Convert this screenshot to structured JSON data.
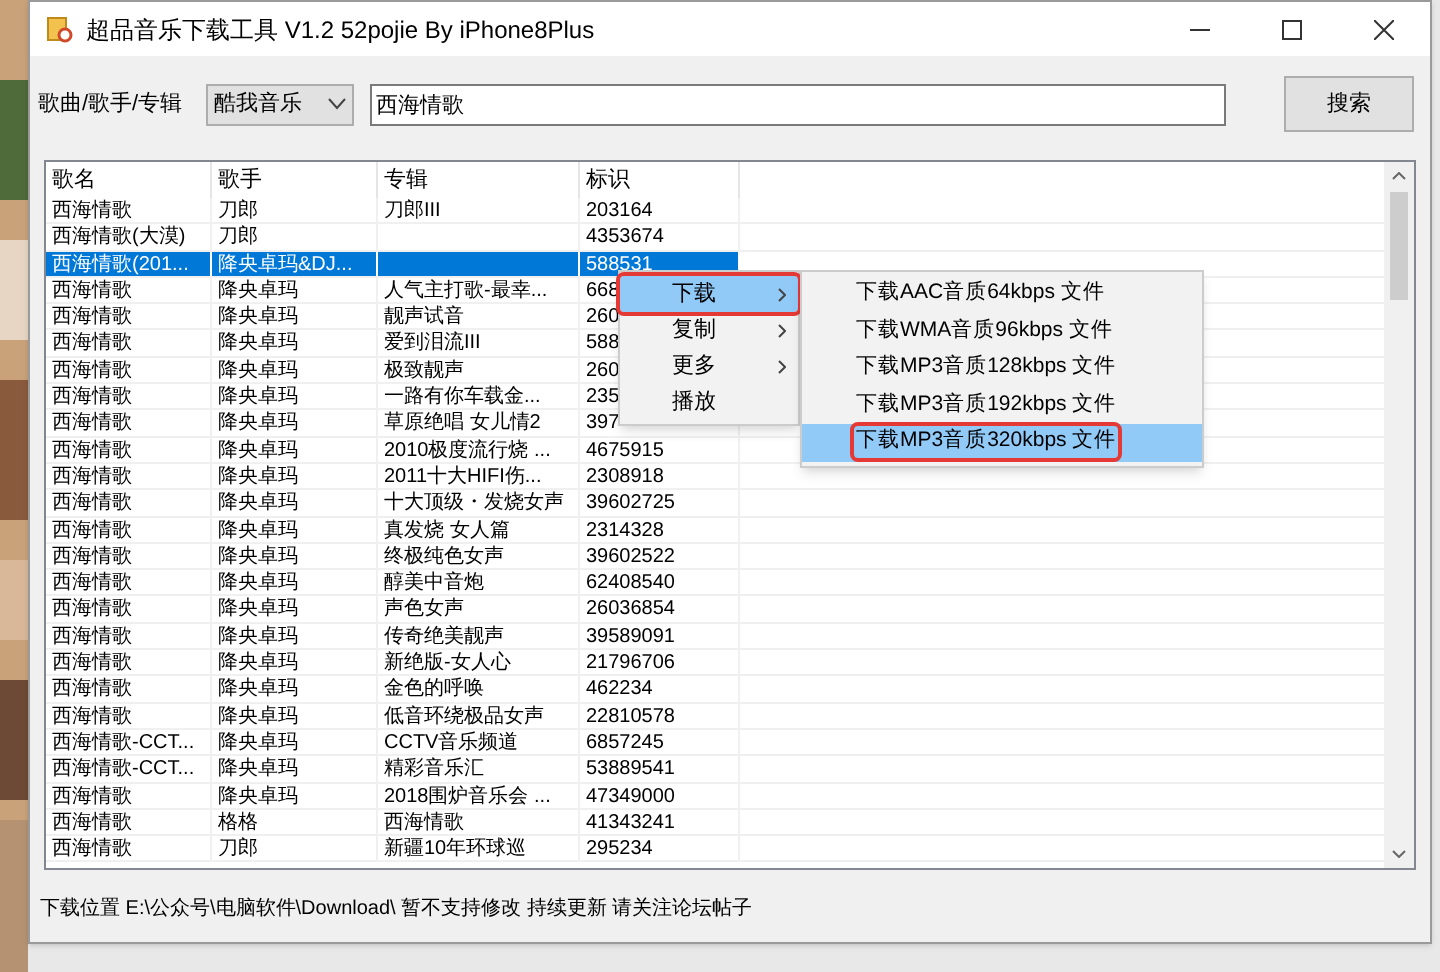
{
  "window": {
    "title": "超品音乐下载工具 V1.2 52pojie By iPhone8Plus"
  },
  "search": {
    "label": "歌曲/歌手/专辑",
    "source": "酷我音乐",
    "value": "西海情歌",
    "button": "搜索"
  },
  "table": {
    "columns": [
      "歌名",
      "歌手",
      "专辑",
      "标识"
    ],
    "rows": [
      {
        "cells": [
          "西海情歌",
          "刀郎",
          "刀郎III",
          "203164"
        ],
        "selected": false
      },
      {
        "cells": [
          "西海情歌(大漠)",
          "刀郎",
          null,
          "4353674"
        ],
        "selected": false
      },
      {
        "cells": [
          "西海情歌(201...",
          "降央卓玛&DJ...",
          null,
          "588531"
        ],
        "selected": true
      },
      {
        "cells": [
          "西海情歌",
          "降央卓玛",
          "人气主打歌-最幸...",
          "668"
        ],
        "selected": false
      },
      {
        "cells": [
          "西海情歌",
          "降央卓玛",
          "靓声试音",
          "260"
        ],
        "selected": false
      },
      {
        "cells": [
          "西海情歌",
          "降央卓玛",
          "爱到泪流III",
          "588"
        ],
        "selected": false
      },
      {
        "cells": [
          "西海情歌",
          "降央卓玛",
          "极致靓声",
          "260"
        ],
        "selected": false
      },
      {
        "cells": [
          "西海情歌",
          "降央卓玛",
          "一路有你车载金...",
          "235"
        ],
        "selected": false
      },
      {
        "cells": [
          "西海情歌",
          "降央卓玛",
          "草原绝唱 女儿情2",
          "397"
        ],
        "selected": false
      },
      {
        "cells": [
          "西海情歌",
          "降央卓玛",
          "2010极度流行烧 ...",
          "4675915"
        ],
        "selected": false
      },
      {
        "cells": [
          "西海情歌",
          "降央卓玛",
          "2011十大HIFI伤...",
          "2308918"
        ],
        "selected": false
      },
      {
        "cells": [
          "西海情歌",
          "降央卓玛",
          "十大顶级・发烧女声",
          "39602725"
        ],
        "selected": false
      },
      {
        "cells": [
          "西海情歌",
          "降央卓玛",
          "真发烧 女人篇",
          "2314328"
        ],
        "selected": false
      },
      {
        "cells": [
          "西海情歌",
          "降央卓玛",
          "终极纯色女声",
          "39602522"
        ],
        "selected": false
      },
      {
        "cells": [
          "西海情歌",
          "降央卓玛",
          "醇美中音炮",
          "62408540"
        ],
        "selected": false
      },
      {
        "cells": [
          "西海情歌",
          "降央卓玛",
          "声色女声",
          "26036854"
        ],
        "selected": false
      },
      {
        "cells": [
          "西海情歌",
          "降央卓玛",
          "传奇绝美靓声",
          "39589091"
        ],
        "selected": false
      },
      {
        "cells": [
          "西海情歌",
          "降央卓玛",
          "新绝版-女人心",
          "21796706"
        ],
        "selected": false
      },
      {
        "cells": [
          "西海情歌",
          "降央卓玛",
          "金色的呼唤",
          "462234"
        ],
        "selected": false
      },
      {
        "cells": [
          "西海情歌",
          "降央卓玛",
          "低音环绕极品女声",
          "22810578"
        ],
        "selected": false
      },
      {
        "cells": [
          "西海情歌-CCT...",
          "降央卓玛",
          "CCTV音乐频道",
          "6857245"
        ],
        "selected": false
      },
      {
        "cells": [
          "西海情歌-CCT...",
          "降央卓玛",
          "精彩音乐汇",
          "53889541"
        ],
        "selected": false
      },
      {
        "cells": [
          "西海情歌",
          "降央卓玛",
          "2018围炉音乐会 ...",
          "47349000"
        ],
        "selected": false
      },
      {
        "cells": [
          "西海情歌",
          "格格",
          "西海情歌",
          "41343241"
        ],
        "selected": false
      },
      {
        "cells": [
          "西海情歌",
          "刀郎",
          "新疆10年环球巡",
          "295234"
        ],
        "selected": false
      }
    ]
  },
  "context_menu": {
    "items": [
      {
        "label": "下载",
        "submenu": true,
        "selected": true,
        "outlined": true
      },
      {
        "label": "复制",
        "submenu": true,
        "selected": false,
        "outlined": false
      },
      {
        "label": "更多",
        "submenu": true,
        "selected": false,
        "outlined": false
      },
      {
        "label": "播放",
        "submenu": false,
        "selected": false,
        "outlined": false
      }
    ]
  },
  "submenu": {
    "items": [
      {
        "label": "下载AAC音质64kbps 文件",
        "selected": false,
        "outlined": false
      },
      {
        "label": "下载WMA音质96kbps 文件",
        "selected": false,
        "outlined": false
      },
      {
        "label": "下载MP3音质128kbps 文件",
        "selected": false,
        "outlined": false
      },
      {
        "label": "下载MP3音质192kbps 文件",
        "selected": false,
        "outlined": false
      },
      {
        "label": "下载MP3音质320kbps 文件",
        "selected": true,
        "outlined": true
      }
    ]
  },
  "status_bar": "下载位置 E:\\公众号\\电脑软件\\Download\\ 暂不支持修改 持续更新 请关注论坛帖子"
}
